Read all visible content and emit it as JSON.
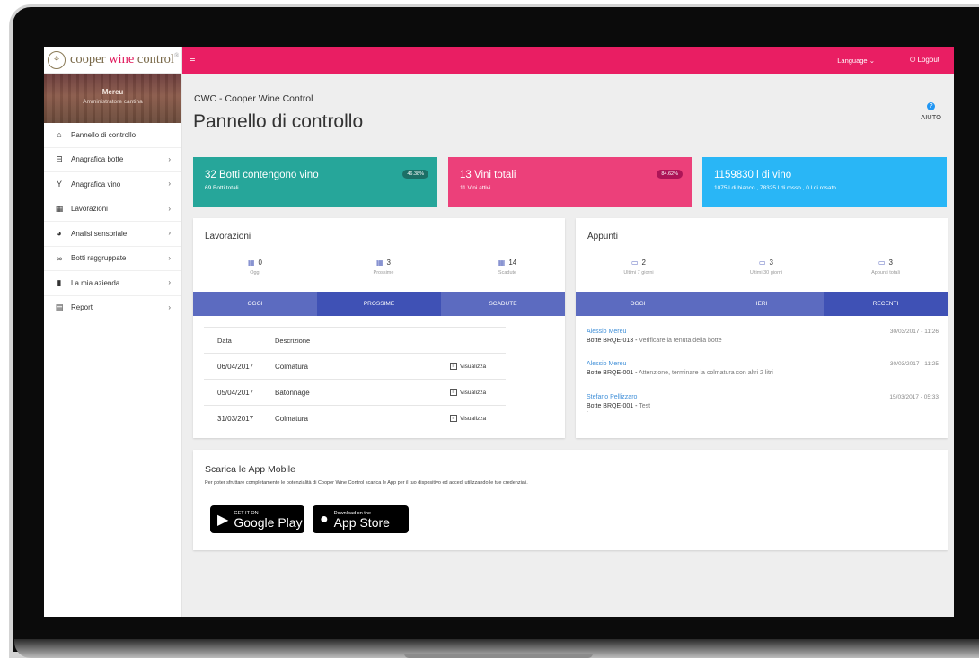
{
  "brand": {
    "name_prefix": "cooper ",
    "name_wine": "wine",
    "name_suffix": " control",
    "mark": "®"
  },
  "profile": {
    "name": "Mereu",
    "role": "Amministratore cantina"
  },
  "sidebar": {
    "items": [
      {
        "label": "Pannello di controllo",
        "icon": "home-icon",
        "has_chevron": false
      },
      {
        "label": "Anagrafica botte",
        "icon": "barrel-icon"
      },
      {
        "label": "Anagrafica vino",
        "icon": "wine-glass-icon"
      },
      {
        "label": "Lavorazioni",
        "icon": "calendar-icon"
      },
      {
        "label": "Analisi sensoriale",
        "icon": "pie-chart-icon"
      },
      {
        "label": "Botti raggruppate",
        "icon": "barrels-group-icon"
      },
      {
        "label": "La mia azienda",
        "icon": "building-icon"
      },
      {
        "label": "Report",
        "icon": "report-icon"
      }
    ]
  },
  "topbar": {
    "language_label": "Language",
    "logout_label": "Logout"
  },
  "header": {
    "breadcrumb": "CWC - Cooper Wine Control",
    "title": "Pannello di controllo",
    "help_label": "AIUTO"
  },
  "stats": [
    {
      "title": "32 Botti contengono vino",
      "subtitle": "69 Botti totali",
      "badge": "46.38%",
      "color": "#26a69a"
    },
    {
      "title": "13 Vini totali",
      "subtitle": "11 Vini attivi",
      "badge": "84.62%",
      "color": "#ec407a"
    },
    {
      "title": "1159830 l di vino",
      "subtitle": "1075 l di bianco , 78325 l di rosso , 0 l di rosato",
      "color": "#29b6f6"
    }
  ],
  "lavorazioni": {
    "title": "Lavorazioni",
    "counters": [
      {
        "value": "0",
        "label": "Oggi"
      },
      {
        "value": "3",
        "label": "Prossime"
      },
      {
        "value": "14",
        "label": "Scadute"
      }
    ],
    "tabs": [
      "OGGI",
      "PROSSIME",
      "SCADUTE"
    ],
    "active_tab": "PROSSIME",
    "columns": [
      "Data",
      "Descrizione"
    ],
    "rows": [
      {
        "date": "06/04/2017",
        "desc": "Colmatura",
        "action": "Visualizza"
      },
      {
        "date": "05/04/2017",
        "desc": "Bâtonnage",
        "action": "Visualizza"
      },
      {
        "date": "31/03/2017",
        "desc": "Colmatura",
        "action": "Visualizza"
      }
    ]
  },
  "appunti": {
    "title": "Appunti",
    "counters": [
      {
        "value": "2",
        "label": "Ultimi 7 giorni"
      },
      {
        "value": "3",
        "label": "Ultimi 30 giorni"
      },
      {
        "value": "3",
        "label": "Appunti totali"
      }
    ],
    "tabs": [
      "OGGI",
      "IERI",
      "RECENTI"
    ],
    "active_tab": "RECENTI",
    "notes": [
      {
        "author": "Alessio Mereu",
        "barrel": "Botte BRQE-013",
        "text": "Verificare la tenuta della botte",
        "date": "30/03/2017 - 11:26"
      },
      {
        "author": "Alessio Mereu",
        "barrel": "Botte BRQE-001",
        "text": "Attenzione, terminare la colmatura con altri 2 litri",
        "date": "30/03/2017 - 11:25"
      },
      {
        "author": "Stefano Pellizzaro",
        "barrel": "Botte BRQE-001",
        "text": "Test",
        "date": "15/03/2017 - 05:33",
        "extra": "-"
      }
    ]
  },
  "mobile": {
    "title": "Scarica le App Mobile",
    "description": "Per poter sfruttare completamente le potenzialità di Cooper Wine Control scarica le App per il tuo dispositivo ed accedi utilizzando le tue credenziali.",
    "google_small": "GET IT ON",
    "google_big": "Google Play",
    "apple_small": "Download on the",
    "apple_big": "App Store"
  }
}
